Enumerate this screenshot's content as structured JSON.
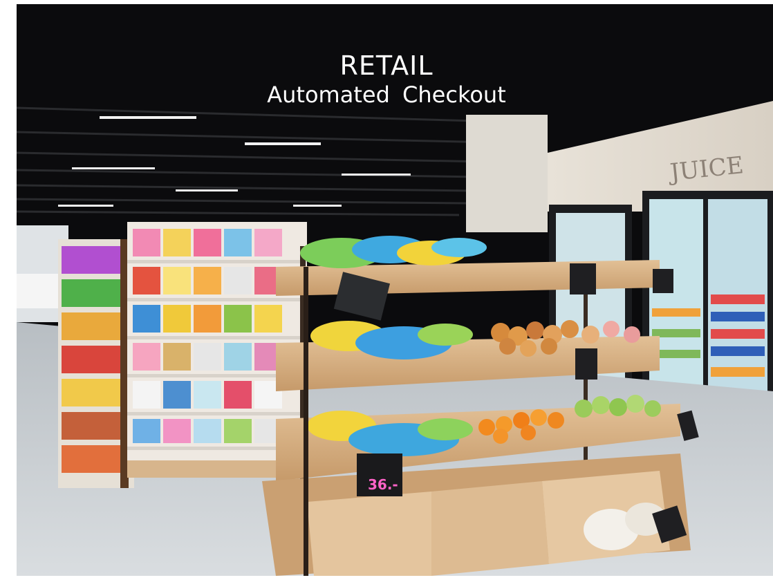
{
  "slide": {
    "title": "RETAIL",
    "subtitle": "Automated Checkout"
  },
  "photo": {
    "wall_sign": "JUICE",
    "price_tags": [
      {
        "text": "36.-",
        "color": "#ff63c8"
      }
    ]
  },
  "colors": {
    "background": "#ffffff",
    "ceiling": "#0b0b0d",
    "shelf_wood": "#d9b48a",
    "floor": "#c9cfd3",
    "title_text": "#ffffff"
  }
}
